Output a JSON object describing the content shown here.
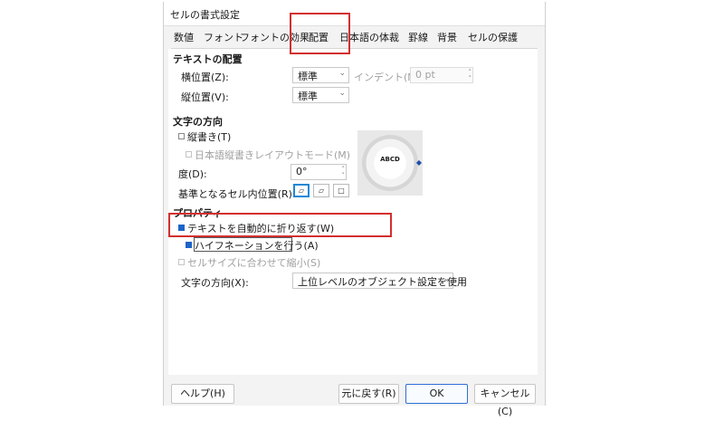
{
  "window": {
    "title": "セルの書式設定"
  },
  "tabs": [
    {
      "label": "数値"
    },
    {
      "label": "フォント"
    },
    {
      "label": "フォントの効果"
    },
    {
      "label": "配置"
    },
    {
      "label": "日本語の体裁"
    },
    {
      "label": "罫線"
    },
    {
      "label": "背景"
    },
    {
      "label": "セルの保護"
    }
  ],
  "text_alignment": {
    "heading": "テキストの配置",
    "horizontal_label": "横位置(Z):",
    "horizontal_value": "標準",
    "indent_label": "インデント(N):",
    "indent_value": "0 pt",
    "vertical_label": "縦位置(V):",
    "vertical_value": "標準"
  },
  "text_direction": {
    "heading": "文字の方向",
    "vertical_stacked_label": "縦書き(T)",
    "asian_layout_label": "日本語縦書きレイアウトモード(M)",
    "degrees_label": "度(D):",
    "degrees_value": "0°",
    "reference_edge_label": "基準となるセル内位置(R):",
    "dial_text": "ABCD"
  },
  "properties": {
    "heading": "プロパティ",
    "wrap_text_label": "テキストを自動的に折り返す(W)",
    "wrap_text_checked": true,
    "hyphenation_label": "ハイフネーションを行う(A)",
    "hyphenation_checked": true,
    "shrink_label": "セルサイズに合わせて縮小(S)",
    "shrink_checked": false,
    "direction_label": "文字の方向(X):",
    "direction_value": "上位レベルのオブジェクト設定を使用"
  },
  "buttons": {
    "help": "ヘルプ(H)",
    "reset": "元に戻す(R)",
    "ok": "OK",
    "cancel": "キャンセル(C)"
  },
  "colors": {
    "highlight_box": "#d32f2f",
    "checkbox_checked": "#1e63c9",
    "ok_border": "#2f6fd6"
  }
}
